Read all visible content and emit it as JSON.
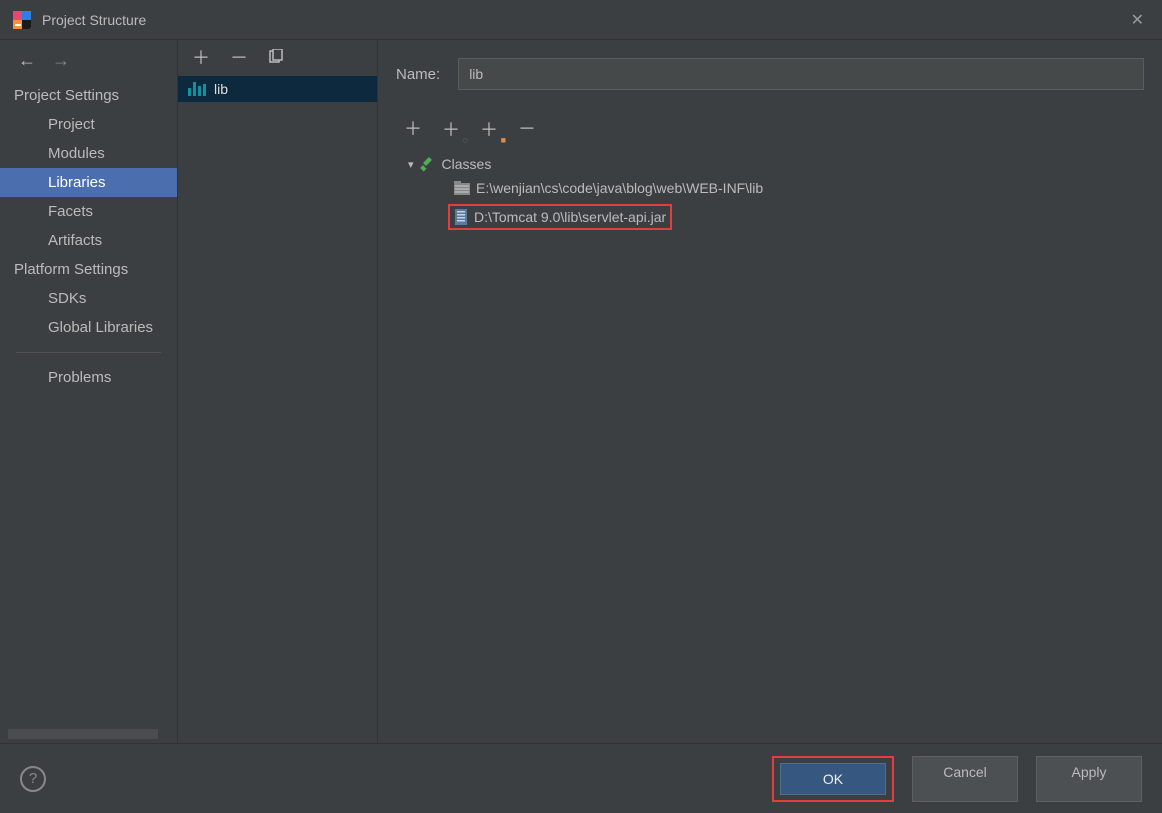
{
  "titlebar": {
    "title": "Project Structure"
  },
  "sidebar": {
    "projectSettingsHeader": "Project Settings",
    "projectSettings": {
      "project": "Project",
      "modules": "Modules",
      "libraries": "Libraries",
      "facets": "Facets",
      "artifacts": "Artifacts"
    },
    "platformSettingsHeader": "Platform Settings",
    "platformSettings": {
      "sdks": "SDKs",
      "globalLibraries": "Global Libraries"
    },
    "problems": "Problems"
  },
  "midPanel": {
    "items": [
      {
        "label": "lib"
      }
    ]
  },
  "detail": {
    "nameLabel": "Name:",
    "nameValue": "lib",
    "tree": {
      "classes": "Classes",
      "path1": "E:\\wenjian\\cs\\code\\java\\blog\\web\\WEB-INF\\lib",
      "path2": "D:\\Tomcat 9.0\\lib\\servlet-api.jar"
    }
  },
  "footer": {
    "ok": "OK",
    "cancel": "Cancel",
    "apply": "Apply"
  }
}
